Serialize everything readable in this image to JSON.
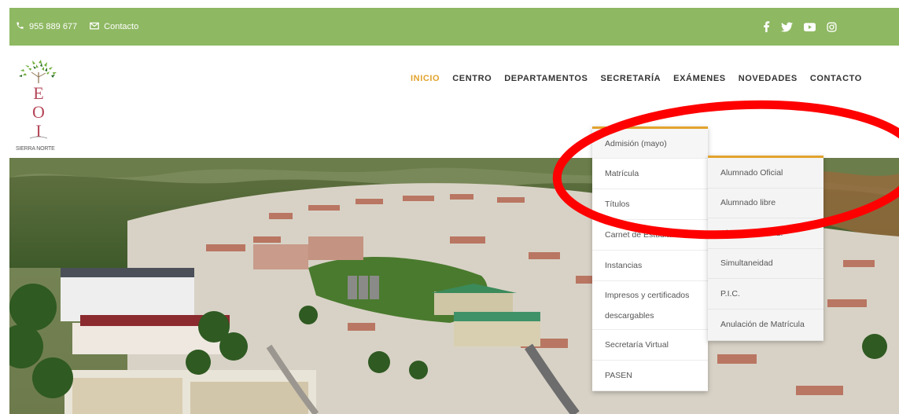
{
  "topbar": {
    "phone": "955 889 677",
    "contact_label": "Contacto",
    "social": [
      "facebook-icon",
      "twitter-icon",
      "youtube-icon",
      "instagram-icon"
    ],
    "bg_color": "#8eb862"
  },
  "logo": {
    "letters": [
      "E",
      "O",
      "I"
    ],
    "text": "SIERRA NORTE"
  },
  "nav": {
    "items": [
      "INICIO",
      "CENTRO",
      "DEPARTAMENTOS",
      "SECRETARÍA",
      "EXÁMENES",
      "NOVEDADES",
      "CONTACTO"
    ],
    "active": "INICIO",
    "accent_color": "#e2a32c"
  },
  "dropdown": {
    "items": [
      "Admisión (mayo)",
      "Matrícula",
      "Títulos",
      "Carnet de Estudiante",
      "Instancias",
      "Impresos y certificados descargables",
      "Secretaría Virtual",
      "PASEN"
    ],
    "hovered": "Matrícula"
  },
  "submenu": {
    "items": [
      "Alumnado Oficial",
      "Alumnado libre",
      "Alumnado C.A.L.",
      "Simultaneidad",
      "P.I.C.",
      "Anulación de Matrícula"
    ]
  },
  "annotation": {
    "color": "#ff0000"
  }
}
